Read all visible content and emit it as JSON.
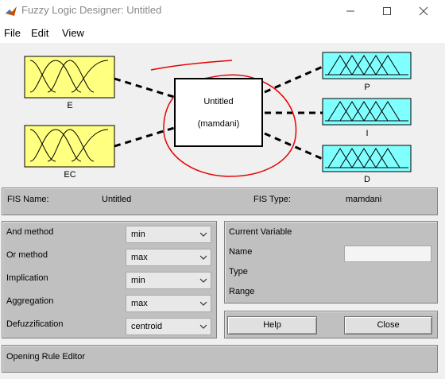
{
  "window": {
    "title": "Fuzzy Logic Designer: Untitled",
    "icon": "matlab-icon"
  },
  "menu": {
    "items": [
      "File",
      "Edit",
      "View"
    ]
  },
  "diagram": {
    "inputs": [
      {
        "label": "E"
      },
      {
        "label": "EC"
      }
    ],
    "outputs": [
      {
        "label": "P"
      },
      {
        "label": "I"
      },
      {
        "label": "D"
      }
    ],
    "system": {
      "name": "Untitled",
      "type": "(mamdani)"
    },
    "colors": {
      "input_fill": "#ffff80",
      "output_fill": "#80ffff",
      "annotation": "#e60000"
    }
  },
  "info": {
    "fis_name_label": "FIS Name:",
    "fis_name_value": "Untitled",
    "fis_type_label": "FIS Type:",
    "fis_type_value": "mamdani"
  },
  "methods": [
    {
      "label": "And method",
      "value": "min"
    },
    {
      "label": "Or method",
      "value": "max"
    },
    {
      "label": "Implication",
      "value": "min"
    },
    {
      "label": "Aggregation",
      "value": "max"
    },
    {
      "label": "Defuzzification",
      "value": "centroid"
    }
  ],
  "current_variable": {
    "title": "Current Variable",
    "name_label": "Name",
    "type_label": "Type",
    "range_label": "Range",
    "name_value": ""
  },
  "buttons": {
    "help": "Help",
    "close": "Close"
  },
  "status": {
    "text": "Opening Rule Editor"
  }
}
